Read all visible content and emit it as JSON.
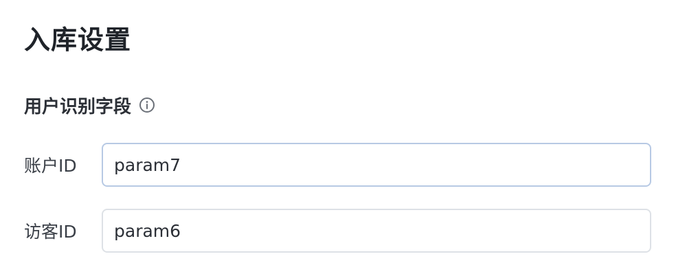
{
  "section": {
    "title": "入库设置"
  },
  "user_id_group": {
    "title": "用户识别字段",
    "info_icon": "info-circle-icon"
  },
  "fields": [
    {
      "label": "账户ID",
      "value": "param7"
    },
    {
      "label": "访客ID",
      "value": "param6"
    }
  ],
  "colors": {
    "focused_border": "#b7c9e4",
    "default_border": "#dde1e6",
    "text": "#2b2f36"
  }
}
